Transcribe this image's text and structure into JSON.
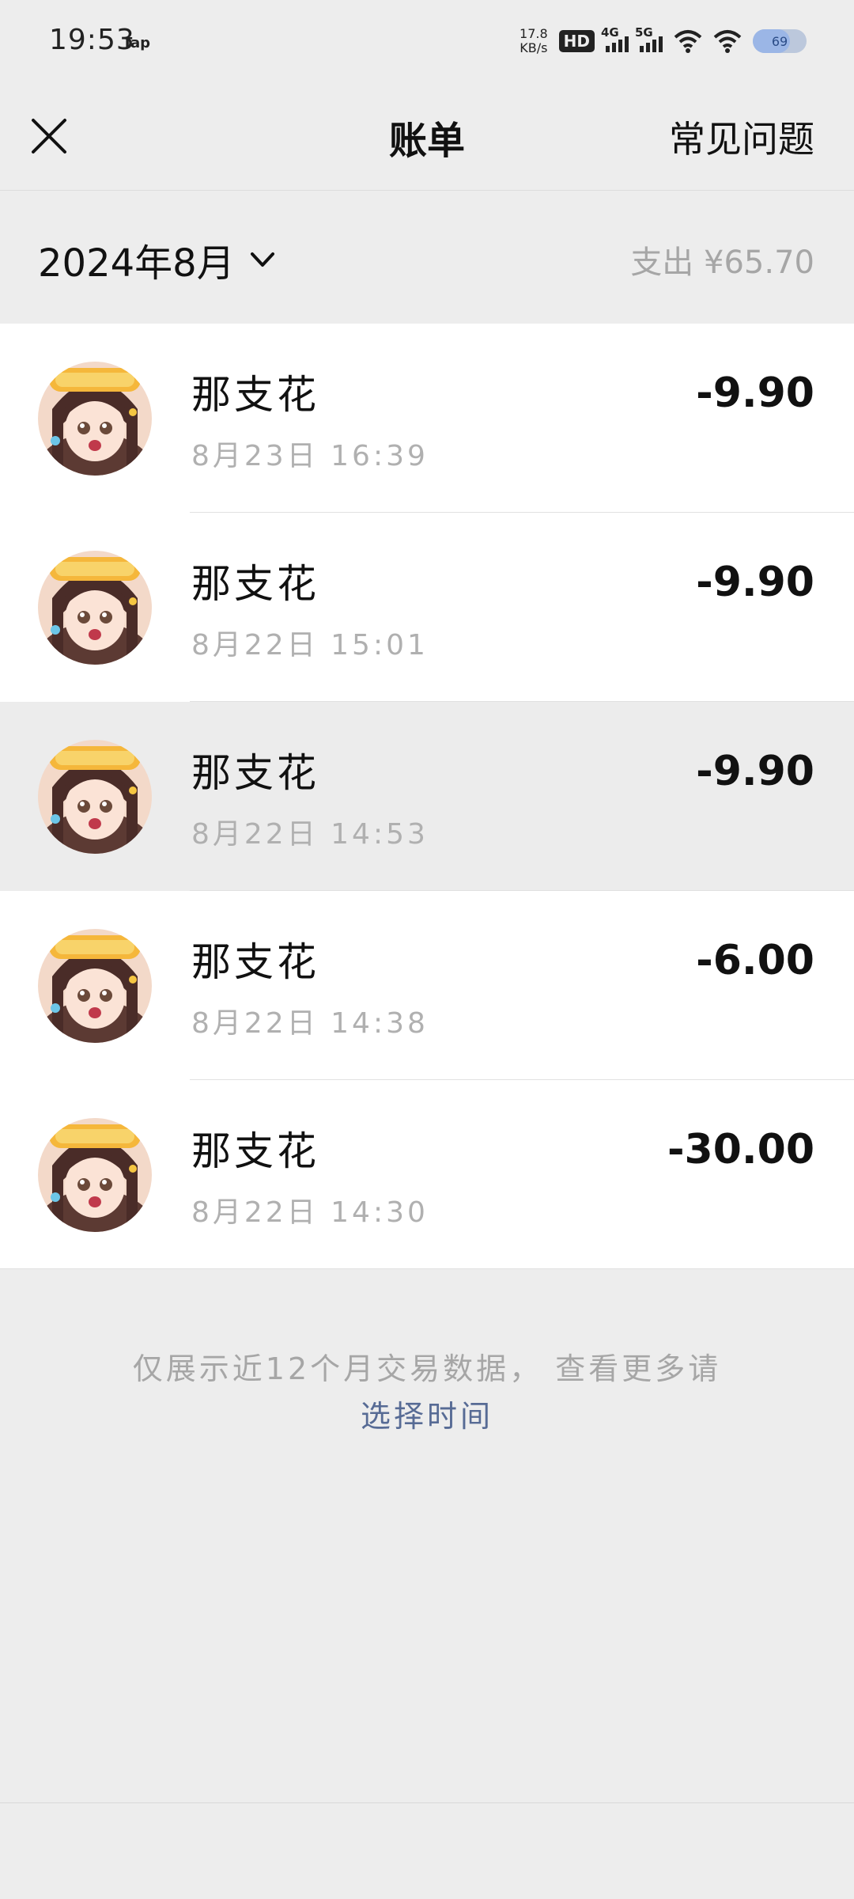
{
  "status_bar": {
    "time": "19:53",
    "app_tag": "Tap",
    "net_speed_value": "17.8",
    "net_speed_unit": "KB/s",
    "hd_label": "HD",
    "signal1_label": "4G",
    "signal2_label": "5G",
    "battery_level": "69",
    "icons": [
      "signal-icon",
      "wifi-icon",
      "battery-icon"
    ]
  },
  "nav": {
    "title": "账单",
    "faq_label": "常见问题",
    "close_icon": "close-icon"
  },
  "month_header": {
    "month_label": "2024年8月",
    "expense_summary": "支出 ¥65.70"
  },
  "transactions": [
    {
      "merchant": "那支花",
      "datetime": "8月23日 16:39",
      "amount": "-9.90"
    },
    {
      "merchant": "那支花",
      "datetime": "8月22日 15:01",
      "amount": "-9.90"
    },
    {
      "merchant": "那支花",
      "datetime": "8月22日 14:53",
      "amount": "-9.90"
    },
    {
      "merchant": "那支花",
      "datetime": "8月22日 14:38",
      "amount": "-6.00"
    },
    {
      "merchant": "那支花",
      "datetime": "8月22日 14:30",
      "amount": "-30.00"
    }
  ],
  "footer": {
    "note": "仅展示近12个月交易数据， 查看更多请",
    "link": "选择时间"
  },
  "colors": {
    "background": "#ededed",
    "link": "#576b95",
    "muted_text": "#a6a6a6"
  }
}
